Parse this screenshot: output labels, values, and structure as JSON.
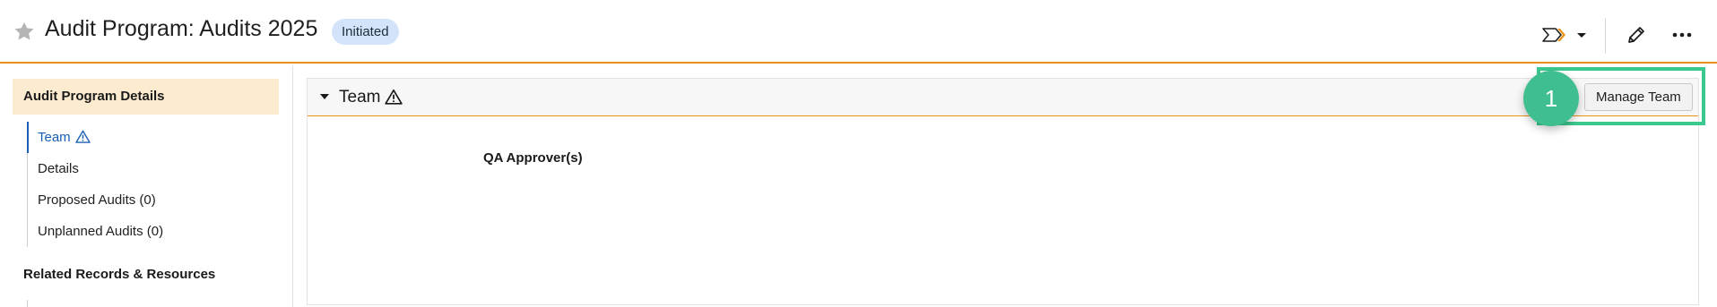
{
  "header": {
    "title": "Audit Program: Audits 2025",
    "status_badge": "Initiated",
    "icons": {
      "favorite": "star-icon",
      "lifecycle": "lifecycle-chevron-icon",
      "dropdown": "caret-down-icon",
      "edit": "pencil-icon",
      "more": "ellipsis-icon"
    }
  },
  "sidebar": {
    "heading": "Audit Program Details",
    "items": [
      {
        "label": "Team",
        "active": true,
        "warning": true
      },
      {
        "label": "Details",
        "active": false,
        "warning": false
      },
      {
        "label": "Proposed Audits (0)",
        "active": false,
        "warning": false
      },
      {
        "label": "Unplanned Audits (0)",
        "active": false,
        "warning": false
      }
    ],
    "related_heading": "Related Records & Resources"
  },
  "section": {
    "title": "Team",
    "manage_button": "Manage Team",
    "fields": [
      {
        "label": "QA Approver(s)",
        "value": ""
      }
    ]
  },
  "callout": {
    "number": "1",
    "color": "#3cc98f"
  },
  "colors": {
    "accent_orange": "#e8941a",
    "link_blue": "#1a5fb4",
    "badge_bg": "#d3e4fa",
    "sidebar_heading_bg": "#fdebd0"
  }
}
